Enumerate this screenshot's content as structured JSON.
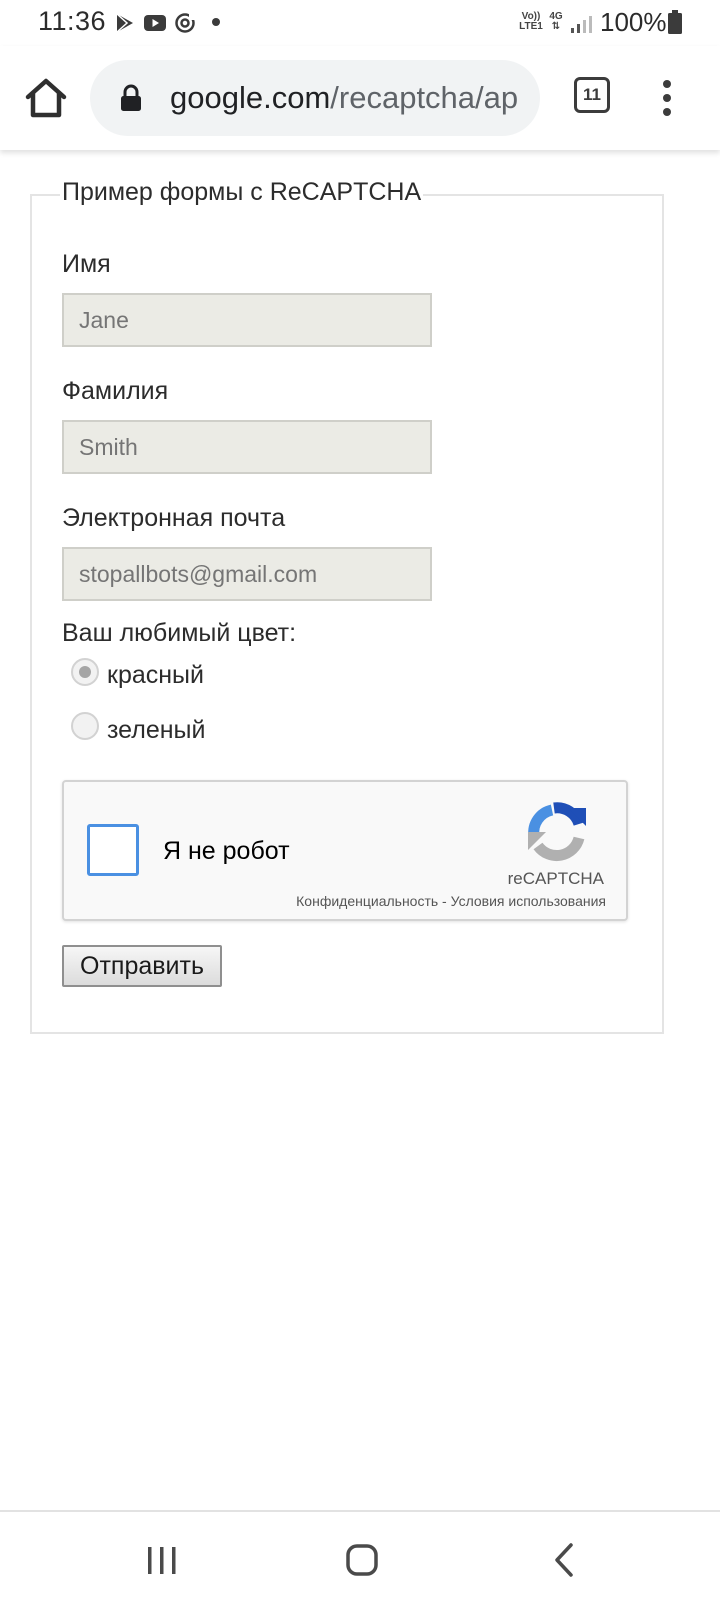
{
  "status_bar": {
    "time": "11:36",
    "notification_icons": [
      "play-store-icon",
      "youtube-icon",
      "sync-icon",
      "dot-icon"
    ],
    "volte_label_top": "Vo))",
    "volte_label_bottom": "LTE1",
    "network_label": "4G",
    "battery_text": "100%"
  },
  "browser": {
    "url_host": "google.com",
    "url_path": "/recaptcha/ap",
    "tab_count": "11"
  },
  "form": {
    "legend": "Пример формы с ReCAPTCHA",
    "first_name": {
      "label": "Имя",
      "value": "Jane"
    },
    "last_name": {
      "label": "Фамилия",
      "value": "Smith"
    },
    "email": {
      "label": "Электронная почта",
      "value": "stopallbots@gmail.com"
    },
    "color_question": "Ваш любимый цвет:",
    "color_options": [
      {
        "label": "красный",
        "checked": true
      },
      {
        "label": "зеленый",
        "checked": false
      }
    ],
    "submit_label": "Отправить"
  },
  "recaptcha": {
    "checkbox_label": "Я не робот",
    "brand": "reCAPTCHA",
    "links": "Конфиденциальность - Условия использования"
  },
  "nav_bar": {
    "buttons": [
      "recent-apps-icon",
      "home-icon",
      "back-icon"
    ]
  }
}
